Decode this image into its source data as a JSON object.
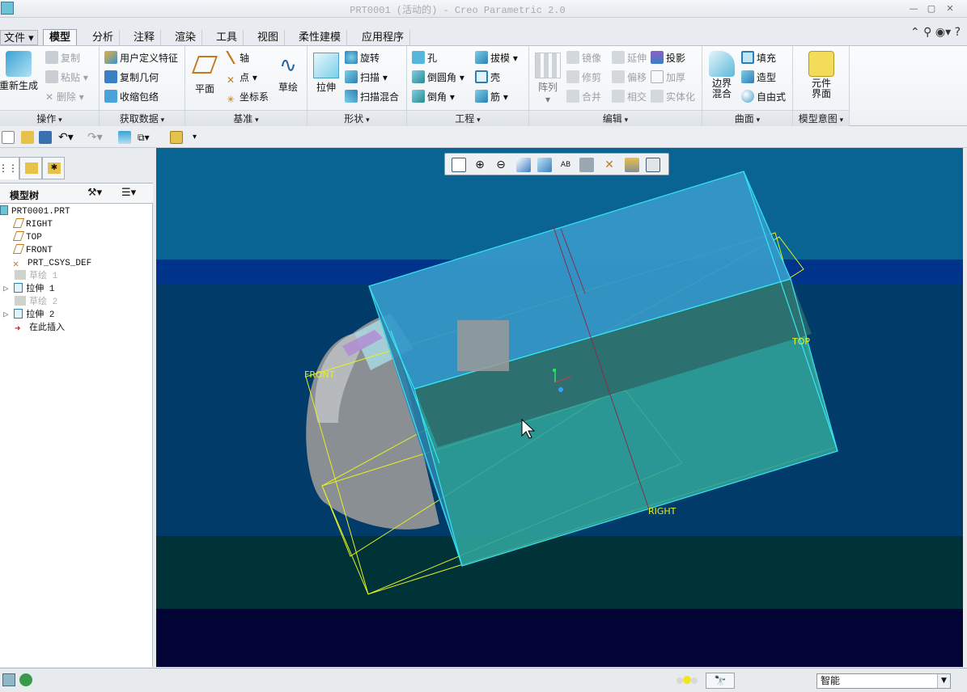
{
  "window": {
    "title": "PRT0001 (活动的) - Creo Parametric 2.0"
  },
  "tabs": [
    {
      "label": "文件 ▾"
    },
    {
      "label": "模型"
    },
    {
      "label": "分析"
    },
    {
      "label": "注释"
    },
    {
      "label": "渲染"
    },
    {
      "label": "工具"
    },
    {
      "label": "视图"
    },
    {
      "label": "柔性建模"
    },
    {
      "label": "应用程序"
    }
  ],
  "ribbon": {
    "groups": {
      "operations": "操作",
      "get_data": "获取数据",
      "datum": "基准",
      "shapes": "形状",
      "engineering": "工程",
      "editing": "编辑",
      "surfaces": "曲面",
      "model_intent": "模型意图"
    },
    "regenerate": "重新生成",
    "copy": "复制",
    "paste": "粘贴",
    "delete": "删除",
    "udf": "用户定义特征",
    "copy_geom": "复制几何",
    "shrinkwrap": "收缩包络",
    "plane": "平面",
    "axis": "轴",
    "point": "点",
    "csys": "坐标系",
    "sketch": "草绘",
    "extrude": "拉伸",
    "revolve": "旋转",
    "sweep": "扫描",
    "swept_blend": "扫描混合",
    "hole": "孔",
    "round": "倒圆角",
    "chamfer": "倒角",
    "draft": "拔模",
    "shell": "壳",
    "rib": "筋",
    "pattern": "阵列",
    "mirror": "镜像",
    "extend": "延伸",
    "project": "投影",
    "trim": "修剪",
    "offset": "偏移",
    "thicken": "加厚",
    "merge": "合并",
    "intersect": "相交",
    "solidify": "实体化",
    "boundary_blend": "边界\n混合",
    "fill": "填充",
    "style": "造型",
    "freestyle": "自由式",
    "component_interface": "元件\n界面"
  },
  "left_panel": {
    "tree_title": "模型树",
    "nodes": [
      {
        "label": "PRT0001.PRT",
        "kind": "part"
      },
      {
        "label": "RIGHT",
        "kind": "plane"
      },
      {
        "label": "TOP",
        "kind": "plane"
      },
      {
        "label": "FRONT",
        "kind": "plane"
      },
      {
        "label": "PRT_CSYS_DEF",
        "kind": "csys"
      },
      {
        "label": "草绘 1",
        "kind": "sketch-hidden"
      },
      {
        "label": "拉伸 1",
        "kind": "extrude"
      },
      {
        "label": "草绘 2",
        "kind": "sketch-hidden"
      },
      {
        "label": "拉伸 2",
        "kind": "extrude"
      },
      {
        "label": "在此插入",
        "kind": "insert"
      }
    ]
  },
  "viewport": {
    "labels": {
      "front": "FRONT",
      "top": "TOP",
      "right": "RIGHT"
    },
    "colors": {
      "bg_top": "#0a6493",
      "bg_band": "#00348a",
      "bg_mid": "#003b6a",
      "bg_low": "#003337",
      "bg_bottom": "#010435",
      "edge": "#35e5f5",
      "datum": "#e6f020"
    }
  },
  "status": {
    "filter": "智能"
  }
}
